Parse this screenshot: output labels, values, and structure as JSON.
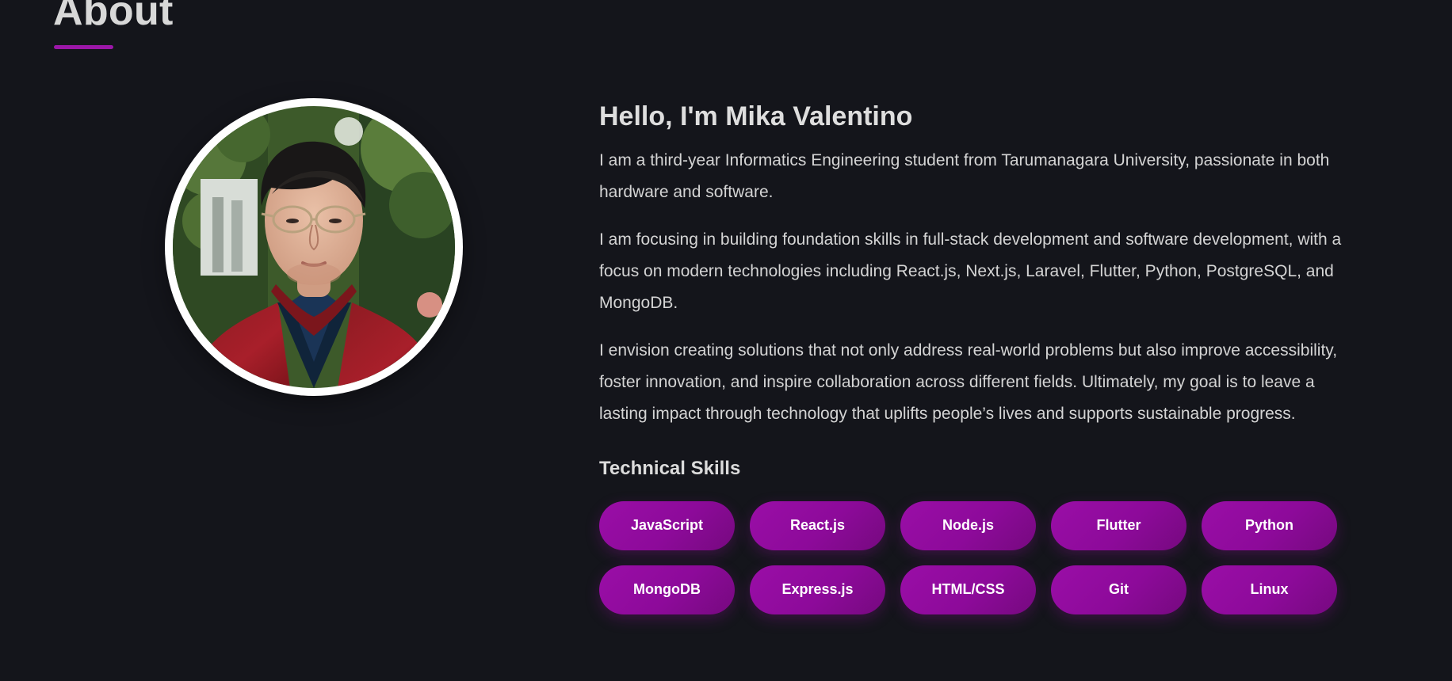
{
  "section": {
    "title": "About"
  },
  "profile": {
    "greeting": "Hello, I'm Mika Valentino",
    "paragraphs": [
      "I am a third-year Informatics Engineering student from Tarumanagara University, passionate in both hardware and software.",
      "I am focusing in building foundation skills in full-stack development and software development, with a focus on modern technologies including React.js, Next.js, Laravel, Flutter, Python, PostgreSQL, and MongoDB.",
      "I envision creating solutions that not only address real-world problems but also improve accessibility, foster innovation, and inspire collaboration across different fields. Ultimately, my goal is to leave a lasting impact through technology that uplifts people’s lives and supports sustainable progress."
    ]
  },
  "skills": {
    "title": "Technical Skills",
    "items": [
      "JavaScript",
      "React.js",
      "Node.js",
      "Flutter",
      "Python",
      "MongoDB",
      "Express.js",
      "HTML/CSS",
      "Git",
      "Linux"
    ]
  },
  "colors": {
    "background": "#14151b",
    "accent": "#9b17a8",
    "text": "#d7d7d7"
  }
}
